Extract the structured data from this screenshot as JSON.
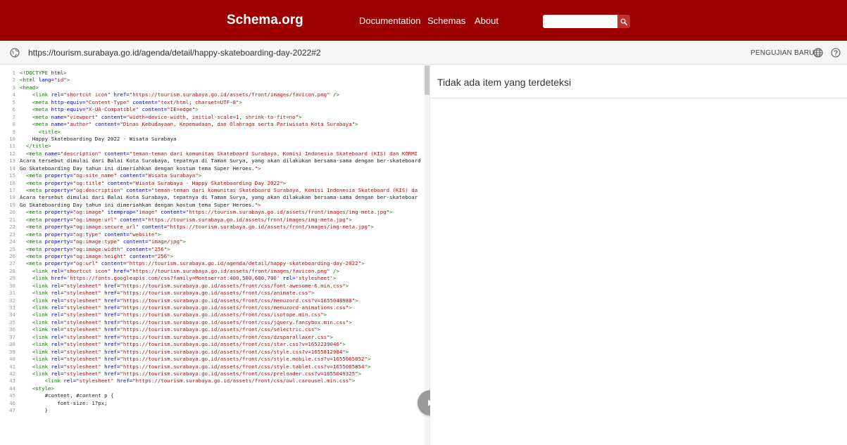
{
  "header": {
    "brand": "Schema.org",
    "nav": [
      "Documentation",
      "Schemas",
      "About"
    ],
    "search_placeholder": ""
  },
  "urlbar": {
    "url": "https://tourism.surabaya.go.id/agenda/detail/happy-skateboarding-day-2022#2",
    "new_test": "PENGUJIAN BARU"
  },
  "result": {
    "message": "Tidak ada item yang terdeteksi"
  },
  "icons": {
    "search": "search-icon",
    "globe": "globe-icon",
    "language": "language-icon",
    "help": "help-icon",
    "play": "play-icon"
  },
  "colors": {
    "header_bg": "#9c0000",
    "search_button": "#c2322f",
    "run_button": "#9a9a9a"
  },
  "code": [
    "<!DOCTYPE html>",
    "<html lang=\"id\">",
    "<head>",
    "    <link rel=\"shortcut icon\" href=\"https://tourism.surabaya.go.id/assets/front/images/favicon.png\" />",
    "    <meta http-equiv=\"Content-Type\" content=\"text/html; charset=UTF-8\">",
    "    <meta http-equiv=\"X-UA-Compatible\" content=\"IE=edge\">",
    "    <meta name=\"viewport\" content=\"width=device-width, initial-scale=1, shrink-to-fit=no\">",
    "    <meta name=\"author\" content=\"Dinas Kebudayaan, Kepemudaan, dan Olahraga serta Pariwisata Kota Surabaya\">",
    "      <title>",
    "    Happy Skateboarding Day 2022 - Wisata Surabaya",
    "  </title>",
    "  <meta name=\"description\" content=\"teman-teman dari komunitas Skateboard Surabaya, Komisi Indonesia Skateboard (KIS) dan KORMI",
    "Acara tersebut dimulai dari Balai Kota Surabaya, tepatnya di Taman Surya, yang akan dilakukan bersama-sama dengan ber-skateboard",
    "Go Skateboarding Day tahun ini dimeriahkan dengan kostum tema Super Heroes.\">",
    "  <meta property=\"og:site_name\" content=\"Wisata Surabaya\">",
    "  <meta property=\"og:title\" content=\"Wisata Surabaya - Happy Skateboarding Day 2022\">",
    "  <meta property=\"og:description\" content=\"teman-teman dari komunitas Skateboard Surabaya, Komisi Indonesia Skateboard (KIS) da",
    "Acara tersebut dimulai dari Balai Kota Surabaya, tepatnya di Taman Surya, yang akan dilakukan bersama-sama dengan ber-skateboar",
    "Go Skateboarding Day tahun ini dimeriahkan dengan kostum tema Super Heroes.\">",
    "  <meta property=\"og:image\" itemprop=\"image\" content=\"https://tourism.surabaya.go.id/assets/front/images/img-meta.jpg\">",
    "  <meta property=\"og:image:url\" content=\"https://tourism.surabaya.go.id/assets/front/images/img-meta.jpg\">",
    "  <meta property=\"og:image:secure_url\" content=\"https://tourism.surabaya.go.id/assets/front/images/img-meta.jpg\">",
    "  <meta property=\"og:type\" content=\"website\">",
    "  <meta property=\"og:image:type\" content=\"image/jpg\">",
    "  <meta property=\"og:image:width\" content=\"256\">",
    "  <meta property=\"og:image:height\" content=\"256\">",
    "  <meta property=\"og:url\" content=\"https://tourism.surabaya.go.id/agenda/detail/happy-skateboarding-day-2022\">",
    "    <link rel=\"shortcut icon\" href=\"https://tourism.surabaya.go.id/assets/front/images/favicon.png\" />",
    "    <link href='https://fonts.googleapis.com/css?family=Montserrat:400,500,600,700' rel='stylesheet'>",
    "    <link rel=\"stylesheet\" href=\"https://tourism.surabaya.go.id/assets/front/css/font-awesome-6.min.css\">",
    "    <link rel=\"stylesheet\" href=\"https://tourism.surabaya.go.id/assets/front/css/animate.css\">",
    "    <link rel=\"stylesheet\" href=\"https://tourism.surabaya.go.id/assets/front/css/menuzord.css?v=1655048988\">",
    "    <link rel=\"stylesheet\" href=\"https://tourism.surabaya.go.id/assets/front/css/menuzord-animations.css\">",
    "    <link rel=\"stylesheet\" href=\"https://tourism.surabaya.go.id/assets/front/css/isotope.min.css\">",
    "    <link rel=\"stylesheet\" href=\"https://tourism.surabaya.go.id/assets/front/css/jquery.fancybox.min.css\">",
    "    <link rel=\"stylesheet\" href=\"https://tourism.surabaya.go.id/assets/front/css/selectric.css\">",
    "    <link rel=\"stylesheet\" href=\"https://tourism.surabaya.go.id/assets/front/css/dzsparallaxer.css\">",
    "    <link rel=\"stylesheet\" href=\"https://tourism.surabaya.go.id/assets/front/css/star.css?v=1652239046\">",
    "    <link rel=\"stylesheet\" href=\"https://tourism.surabaya.go.id/assets/front/css/style.css?v=1655812984\">",
    "    <link rel=\"stylesheet\" href=\"https://tourism.surabaya.go.id/assets/front/css/style.mobile.css?v=1655065852\">",
    "    <link rel=\"stylesheet\" href=\"https://tourism.surabaya.go.id/assets/front/css/style.tablet.css?v=1655065854\">",
    "    <link rel=\"stylesheet\" href=\"https://tourism.surabaya.go.id/assets/front/css/preloader.css?v=1655049325\">",
    "        <link rel=\"stylesheet\" href=\"https://tourism.surabaya.go.id/assets/front/css/owl.carousel.min.css\">",
    "    <style>",
    "        #content, #content p {",
    "            font-size: 17px;",
    "        }"
  ]
}
